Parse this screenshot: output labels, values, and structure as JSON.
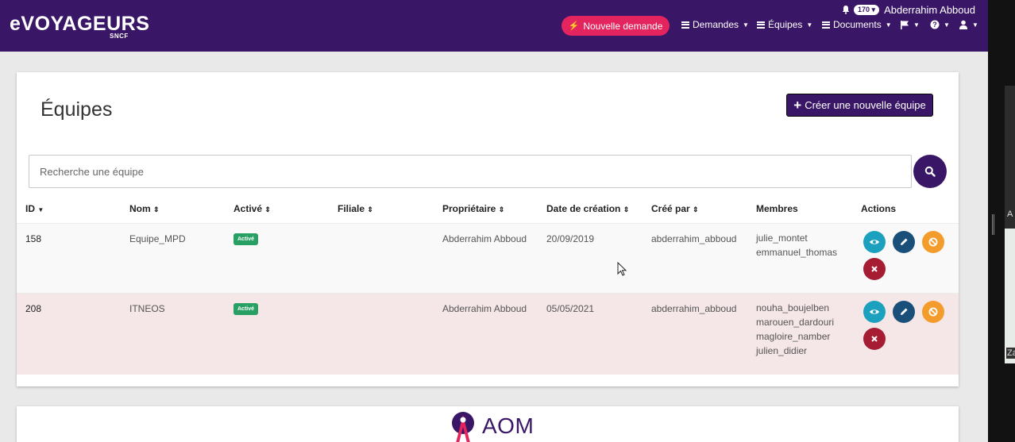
{
  "header": {
    "logo": "eVOYAGEURS",
    "logo_sub": "SNCF",
    "notification_count": "170",
    "user_name": "Abderrahim Abboud",
    "new_request_label": "Nouvelle demande",
    "nav": [
      {
        "label": "Demandes"
      },
      {
        "label": "Équipes"
      },
      {
        "label": "Documents"
      }
    ]
  },
  "page": {
    "title": "Équipes",
    "create_label": "Créer une nouvelle équipe",
    "search_placeholder": "Recherche une équipe"
  },
  "table": {
    "headers": [
      "ID",
      "Nom",
      "Activé",
      "Filiale",
      "Propriétaire",
      "Date de création",
      "Créé par",
      "Membres",
      "Actions"
    ],
    "rows": [
      {
        "id": "158",
        "name": "Equipe_MPD",
        "status": "Activé",
        "filiale": "",
        "owner": "Abderrahim Abboud",
        "created": "20/09/2019",
        "created_by": "abderrahim_abboud",
        "members": [
          "julie_montet",
          "emmanuel_thomas"
        ]
      },
      {
        "id": "208",
        "name": "ITNEOS",
        "status": "Activé",
        "filiale": "",
        "owner": "Abderrahim Abboud",
        "created": "05/05/2021",
        "created_by": "abderrahim_abboud",
        "members": [
          "nouha_boujelben",
          "marouen_dardouri",
          "magloire_namber",
          "julien_didier"
        ]
      }
    ]
  },
  "footer": {
    "aom_label": "AOM"
  },
  "side": {
    "letter_a": "A",
    "letter_b": "Za"
  },
  "colors": {
    "brand": "#3a1766",
    "accent": "#e4245e",
    "active_badge": "#28a064",
    "view": "#1ba0bd",
    "edit": "#1a4f7a",
    "ban": "#f39c2b",
    "delete": "#a51c33"
  }
}
